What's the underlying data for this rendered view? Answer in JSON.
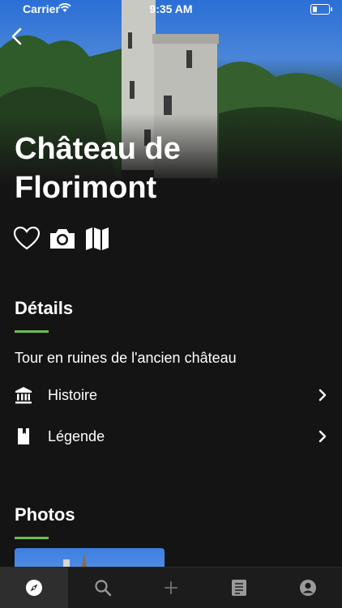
{
  "status_bar": {
    "carrier": "Carrier",
    "time": "9:35 AM",
    "battery_level": 0.2
  },
  "place": {
    "title": "Château de Florimont"
  },
  "actions": [
    {
      "name": "favorite",
      "icon": "heart-icon"
    },
    {
      "name": "photo",
      "icon": "camera-icon"
    },
    {
      "name": "map",
      "icon": "map-icon"
    }
  ],
  "details": {
    "heading": "Détails",
    "description": "Tour en ruines de l'ancien château",
    "items": [
      {
        "label": "Histoire",
        "icon": "museum-icon"
      },
      {
        "label": "Légende",
        "icon": "book-icon"
      }
    ]
  },
  "photos": {
    "heading": "Photos"
  },
  "tabbar": {
    "active": "explore",
    "tabs": [
      {
        "name": "explore",
        "icon": "compass-icon"
      },
      {
        "name": "search",
        "icon": "search-icon"
      },
      {
        "name": "add",
        "icon": "plus-icon"
      },
      {
        "name": "list",
        "icon": "list-icon"
      },
      {
        "name": "profile",
        "icon": "user-icon"
      }
    ]
  },
  "colors": {
    "accent": "#6dbf4a",
    "background": "#141414",
    "tabbar": "#1c1c1c"
  }
}
